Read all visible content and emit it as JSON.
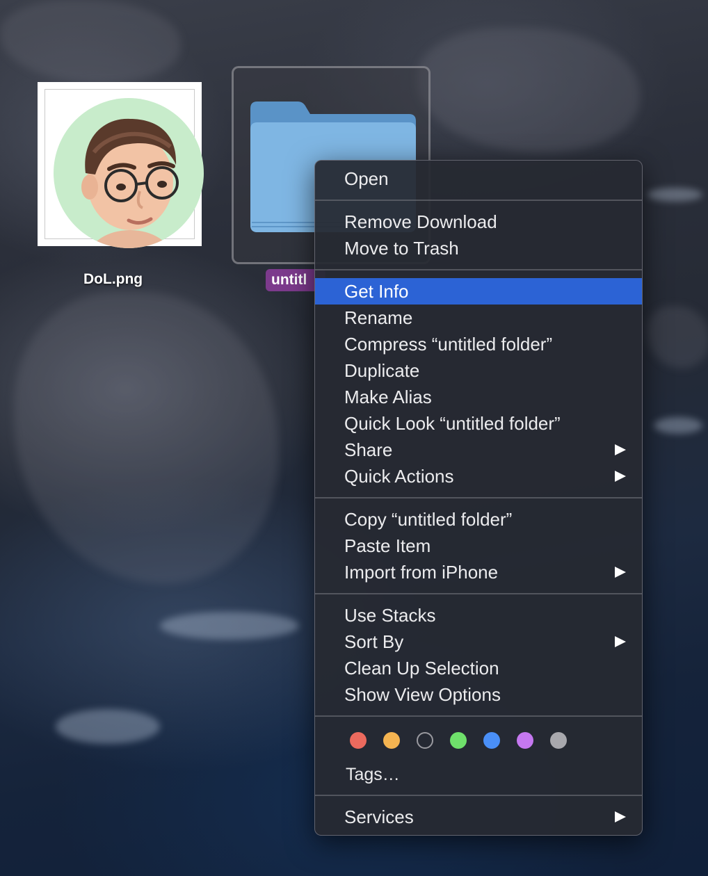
{
  "desktop": {
    "icons": [
      {
        "label": "DoL.png"
      },
      {
        "label": "untitl"
      }
    ]
  },
  "context_menu": {
    "items": {
      "open": "Open",
      "remove_download": "Remove Download",
      "move_to_trash": "Move to Trash",
      "get_info": "Get Info",
      "rename": "Rename",
      "compress": "Compress “untitled folder”",
      "duplicate": "Duplicate",
      "make_alias": "Make Alias",
      "quick_look": "Quick Look “untitled folder”",
      "share": "Share",
      "quick_actions": "Quick Actions",
      "copy": "Copy “untitled folder”",
      "paste_item": "Paste Item",
      "import_from_iphone": "Import from iPhone",
      "use_stacks": "Use Stacks",
      "sort_by": "Sort By",
      "clean_up_selection": "Clean Up Selection",
      "show_view_options": "Show View Options",
      "tags": "Tags…",
      "services": "Services"
    },
    "highlighted_item": "Get Info",
    "tag_colors": [
      {
        "name": "red",
        "color": "#ec6a5e"
      },
      {
        "name": "orange",
        "color": "#f5b451"
      },
      {
        "name": "none",
        "color": "transparent"
      },
      {
        "name": "green",
        "color": "#6fe06b"
      },
      {
        "name": "blue",
        "color": "#4a8ff7"
      },
      {
        "name": "purple",
        "color": "#c578f0"
      },
      {
        "name": "gray",
        "color": "#a8a8ad"
      }
    ],
    "highlight_color": "#2c63d5"
  }
}
